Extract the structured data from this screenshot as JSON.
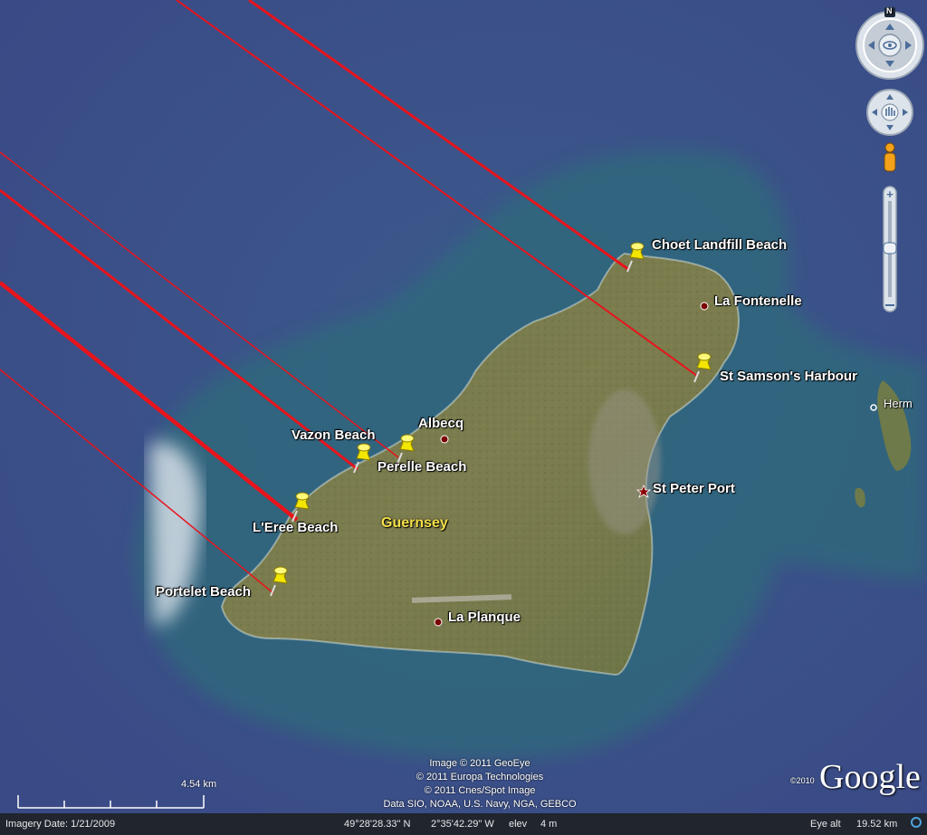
{
  "places": {
    "albecq": "Albecq",
    "la_fontenelle": "La Fontenelle",
    "st_peter_port": "St Peter Port",
    "la_planque": "La Planque",
    "herm": "Herm",
    "guernsey": "Guernsey"
  },
  "beaches": {
    "choet": "Choet Landfill Beach",
    "st_samson": "St Samson's Harbour",
    "vazon": "Vazon Beach",
    "perelle": "Perelle Beach",
    "leree": "L'Eree Beach",
    "portelet": "Portelet Beach"
  },
  "attribution": {
    "line1": "Image © 2011 GeoEye",
    "line2": "© 2011 Europa Technologies",
    "line3": "© 2011 Cnes/Spot Image",
    "line4": "Data SIO, NOAA, U.S. Navy, NGA, GEBCO"
  },
  "scale_label": "4.54 km",
  "google": {
    "year": "©2010",
    "logo": "Google"
  },
  "status": {
    "imagery_date": "Imagery Date: 1/21/2009",
    "lat": "49°28'28.33\" N",
    "lon": "2°35'42.29\" W",
    "elev_label": "elev",
    "elev_value": "4 m",
    "eye_label": "Eye alt",
    "eye_value": "19.52 km"
  },
  "compass_north": "N",
  "icons": [
    "push-pin-icon",
    "place-dot-icon",
    "capital-star-icon",
    "navigation-compass-icon",
    "pan-hand-icon",
    "street-view-pegman-icon",
    "zoom-in-icon",
    "zoom-out-icon",
    "status-indicator-icon"
  ],
  "colors": {
    "sea": "#3a4f86",
    "path_line": "#e8141c",
    "pin": "#f3e600",
    "label": "#ffffff",
    "island_label": "#f4e04a",
    "status_bg": "#20252e"
  }
}
